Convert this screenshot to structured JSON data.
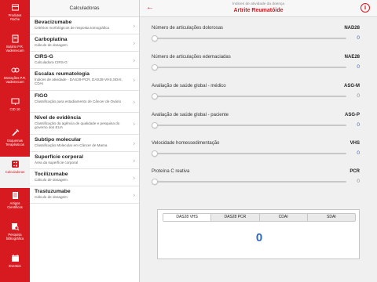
{
  "colors": {
    "accent": "#d71920",
    "value_blue": "#2f67c7"
  },
  "nav": {
    "items": [
      {
        "label": "Produtos\nRoche",
        "icon": "box-icon"
      },
      {
        "label": "Bulário P.R.\nVademecum",
        "icon": "book-icon"
      },
      {
        "label": "Interações P.R.\nVademecum",
        "icon": "interactions-icon"
      },
      {
        "label": "CID 10",
        "icon": "monitor-icon"
      },
      {
        "label": "Esquemas\nTerapêuticos",
        "icon": "syringe-icon"
      },
      {
        "label": "Calculadoras",
        "icon": "calculator-icon",
        "active": true
      },
      {
        "label": "Artigos\nCientíficos",
        "icon": "article-icon"
      },
      {
        "label": "Pesquisa\nbibliográfica",
        "icon": "search-book-icon"
      },
      {
        "label": "Eventos",
        "icon": "calendar-icon"
      }
    ]
  },
  "list": {
    "header": "Calculadoras",
    "items": [
      {
        "title": "Bevacizumabe",
        "subtitle": "Critérios morfológicos de resposta tomográfica"
      },
      {
        "title": "Carboplatina",
        "subtitle": "Cálculo de dosagem"
      },
      {
        "title": "CIRS-G",
        "subtitle": "Calculadora CIRS-G"
      },
      {
        "title": "Escalas reumatologia",
        "subtitle": "Índices de atividade - DAS28-PCR, DAS28-VHS,SDAI, CDAI"
      },
      {
        "title": "FIGO",
        "subtitle": "Classificação para estadiamento de Câncer de Ovário"
      },
      {
        "title": "Nível de evidência",
        "subtitle": "Classificação da agência de qualidade e pesquisa do governo dos EUA"
      },
      {
        "title": "Subtipo molecular",
        "subtitle": "Classificação Molecular em Câncer de Mama"
      },
      {
        "title": "Superfície corporal",
        "subtitle": "Área da superfície corporal"
      },
      {
        "title": "Tocilizumabe",
        "subtitle": "Cálculo de dosagem"
      },
      {
        "title": "Trastuzumabe",
        "subtitle": "Cálculo de dosagem"
      }
    ]
  },
  "header": {
    "subtitle": "Índices de atividade da doença",
    "title": "Artrite Reumatóide",
    "back_icon": "arrow-left-icon",
    "info_icon": "info-icon"
  },
  "params": [
    {
      "label": "Número de articulações dolorosas",
      "code": "NAD28",
      "value": "0",
      "active": true
    },
    {
      "label": "Número de articulações edemaciadas",
      "code": "NAE28",
      "value": "0",
      "active": true
    },
    {
      "label": "Avaliação de saúde global - médico",
      "code": "ASG-M",
      "value": "0",
      "active": false
    },
    {
      "label": "Avaliação de saúde global - paciente",
      "code": "ASG-P",
      "value": "0",
      "active": true
    },
    {
      "label": "Velocidade homessedimentação",
      "code": "VHS",
      "value": "0",
      "active": true
    },
    {
      "label": "Proteína C reativa",
      "code": "PCR",
      "value": "0",
      "active": false
    }
  ],
  "result": {
    "tabs": [
      "DAS28 VHS",
      "DAS28 PCR",
      "CDAI",
      "SDAI"
    ],
    "selected_tab": "DAS28 VHS",
    "value": "0"
  }
}
